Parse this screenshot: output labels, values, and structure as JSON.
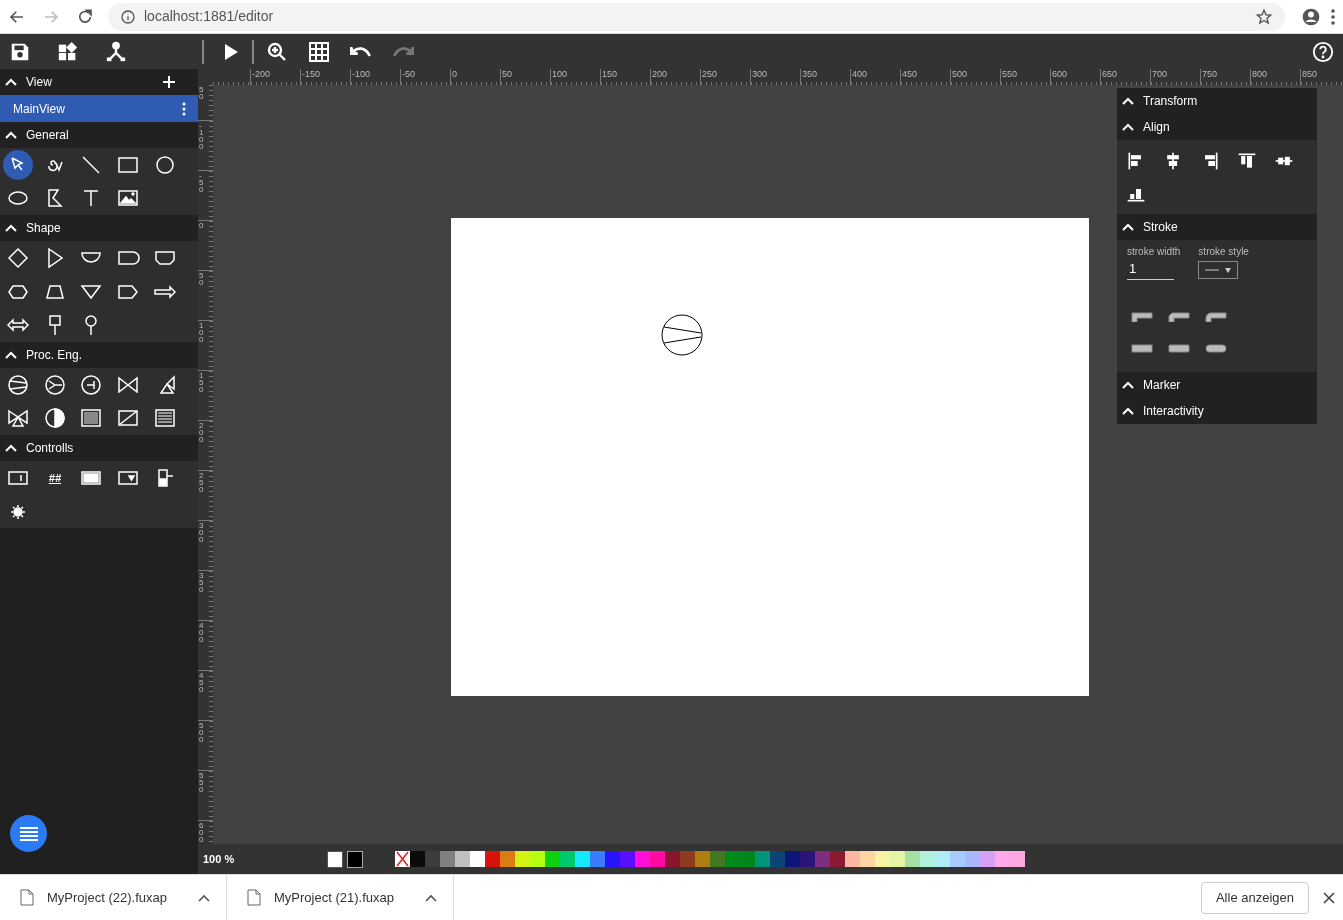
{
  "browser": {
    "url": "localhost:1881/editor",
    "back_disabled": false,
    "forward_disabled": true
  },
  "toolbar": [
    {
      "kind": "play",
      "disabled": false
    },
    {
      "kind": "zoom",
      "disabled": false
    },
    {
      "kind": "grid",
      "disabled": false
    },
    {
      "kind": "undo",
      "disabled": false
    },
    {
      "kind": "redo",
      "disabled": true
    }
  ],
  "sidebar": {
    "view_section": {
      "title": "View",
      "views": [
        {
          "name": "MainView",
          "selected": true
        }
      ]
    },
    "sections": [
      {
        "title": "General",
        "tools": [
          {
            "kind": "pointer",
            "selected": true
          },
          {
            "kind": "spiral",
            "selected": false
          },
          {
            "kind": "line",
            "selected": false
          },
          {
            "kind": "rect",
            "selected": false
          },
          {
            "kind": "circle",
            "selected": false
          },
          {
            "kind": "ellipse",
            "selected": false
          },
          {
            "kind": "polyline",
            "selected": false
          },
          {
            "kind": "text",
            "selected": false
          },
          {
            "kind": "image",
            "selected": false
          }
        ]
      },
      {
        "title": "Shape",
        "tools": [
          {
            "kind": "diamond",
            "selected": false
          },
          {
            "kind": "triangle",
            "selected": false
          },
          {
            "kind": "halfround",
            "selected": false
          },
          {
            "kind": "pill",
            "selected": false
          },
          {
            "kind": "bucket",
            "selected": false
          },
          {
            "kind": "hexagon",
            "selected": false
          },
          {
            "kind": "trapezoid",
            "selected": false
          },
          {
            "kind": "funnel",
            "selected": false
          },
          {
            "kind": "tag",
            "selected": false
          },
          {
            "kind": "arrow",
            "selected": false
          },
          {
            "kind": "doublearrow",
            "selected": false
          },
          {
            "kind": "sign",
            "selected": false
          },
          {
            "kind": "pin",
            "selected": false
          }
        ]
      },
      {
        "title": "Proc. Eng.",
        "tools": [
          {
            "kind": "pump",
            "selected": false
          },
          {
            "kind": "fan",
            "selected": false
          },
          {
            "kind": "motor",
            "selected": false
          },
          {
            "kind": "valve",
            "selected": false
          },
          {
            "kind": "anglevalve",
            "selected": false
          },
          {
            "kind": "threevalve",
            "selected": false
          },
          {
            "kind": "halfcircle",
            "selected": false
          },
          {
            "kind": "checker",
            "selected": false
          },
          {
            "kind": "diagonal",
            "selected": false
          },
          {
            "kind": "stripes",
            "selected": false
          }
        ]
      },
      {
        "title": "Controlls",
        "tools": [
          {
            "kind": "input",
            "selected": false
          },
          {
            "kind": "value",
            "label": "##",
            "selected": false
          },
          {
            "kind": "button",
            "selected": false
          },
          {
            "kind": "select",
            "selected": false
          },
          {
            "kind": "switch",
            "selected": false
          },
          {
            "kind": "light",
            "selected": false
          }
        ]
      }
    ]
  },
  "ruler": {
    "x_labels": [
      "-200",
      "-150",
      "-100",
      "-50",
      "0",
      "50",
      "100",
      "150",
      "200",
      "250",
      "300",
      "350",
      "400",
      "450",
      "500",
      "550",
      "600",
      "650",
      "700",
      "750",
      "800",
      "850"
    ],
    "y_labels": [
      "50",
      "-100",
      "-50",
      "0",
      "50",
      "100",
      "150",
      "200",
      "250",
      "300",
      "350",
      "400",
      "450",
      "500",
      "550",
      "600"
    ]
  },
  "canvas": {
    "shapes": [
      {
        "kind": "pump"
      }
    ]
  },
  "properties": [
    {
      "title": "Transform",
      "kind": "plain"
    },
    {
      "title": "Align",
      "kind": "align"
    },
    {
      "title": "Stroke",
      "kind": "stroke",
      "width_label": "stroke width",
      "width_value": "1",
      "style_label": "stroke style"
    },
    {
      "title": "Marker",
      "kind": "plain"
    },
    {
      "title": "Interactivity",
      "kind": "plain"
    }
  ],
  "palette": {
    "zoom": "100 %",
    "current_colors": [
      {
        "color": "#ffffff"
      },
      {
        "color": "#000000"
      }
    ],
    "swatches": [
      {
        "kind": "none"
      },
      {
        "kind": "color",
        "color": "#0a0a0a"
      },
      {
        "kind": "color",
        "color": "#3d3d3d"
      },
      {
        "kind": "color",
        "color": "#808080"
      },
      {
        "kind": "color",
        "color": "#c0c0c0"
      },
      {
        "kind": "color",
        "color": "#ffffff"
      },
      {
        "kind": "color",
        "color": "#d8130b"
      },
      {
        "kind": "color",
        "color": "#d97d14"
      },
      {
        "kind": "color",
        "color": "#d4f215"
      },
      {
        "kind": "color",
        "color": "#b6ff12"
      },
      {
        "kind": "color",
        "color": "#0ed10e"
      },
      {
        "kind": "color",
        "color": "#00c86c"
      },
      {
        "kind": "color",
        "color": "#14e9ff"
      },
      {
        "kind": "color",
        "color": "#3b7bff"
      },
      {
        "kind": "color",
        "color": "#2814ff"
      },
      {
        "kind": "color",
        "color": "#5a10ff"
      },
      {
        "kind": "color",
        "color": "#ff0fd8"
      },
      {
        "kind": "color",
        "color": "#ff0aa0"
      },
      {
        "kind": "color",
        "color": "#8a1530"
      },
      {
        "kind": "color",
        "color": "#8f3b1f"
      },
      {
        "kind": "color",
        "color": "#b07e10"
      },
      {
        "kind": "color",
        "color": "#42781f"
      },
      {
        "kind": "color",
        "color": "#008a1c"
      },
      {
        "kind": "color",
        "color": "#00861a"
      },
      {
        "kind": "color",
        "color": "#009478"
      },
      {
        "kind": "color",
        "color": "#0a4575"
      },
      {
        "kind": "color",
        "color": "#0e1578"
      },
      {
        "kind": "color",
        "color": "#2a1478"
      },
      {
        "kind": "color",
        "color": "#7d2e80"
      },
      {
        "kind": "color",
        "color": "#8a1a30"
      },
      {
        "kind": "color",
        "color": "#ffb7a3"
      },
      {
        "kind": "color",
        "color": "#ffd6a3"
      },
      {
        "kind": "color",
        "color": "#f6f4a3"
      },
      {
        "kind": "color",
        "color": "#e4f5a8"
      },
      {
        "kind": "color",
        "color": "#a5e0a5"
      },
      {
        "kind": "color",
        "color": "#b0f0dc"
      },
      {
        "kind": "color",
        "color": "#b0ecf5"
      },
      {
        "kind": "color",
        "color": "#a6ccff"
      },
      {
        "kind": "color",
        "color": "#a6b8ff"
      },
      {
        "kind": "color",
        "color": "#d6a0f5"
      },
      {
        "kind": "color",
        "color": "#ffa8ec"
      },
      {
        "kind": "color",
        "color": "#ffa8e0"
      }
    ]
  },
  "downloads": {
    "files": [
      {
        "name": "MyProject (22).fuxap"
      },
      {
        "name": "MyProject (21).fuxap"
      }
    ],
    "show_all": "Alle anzeigen"
  }
}
